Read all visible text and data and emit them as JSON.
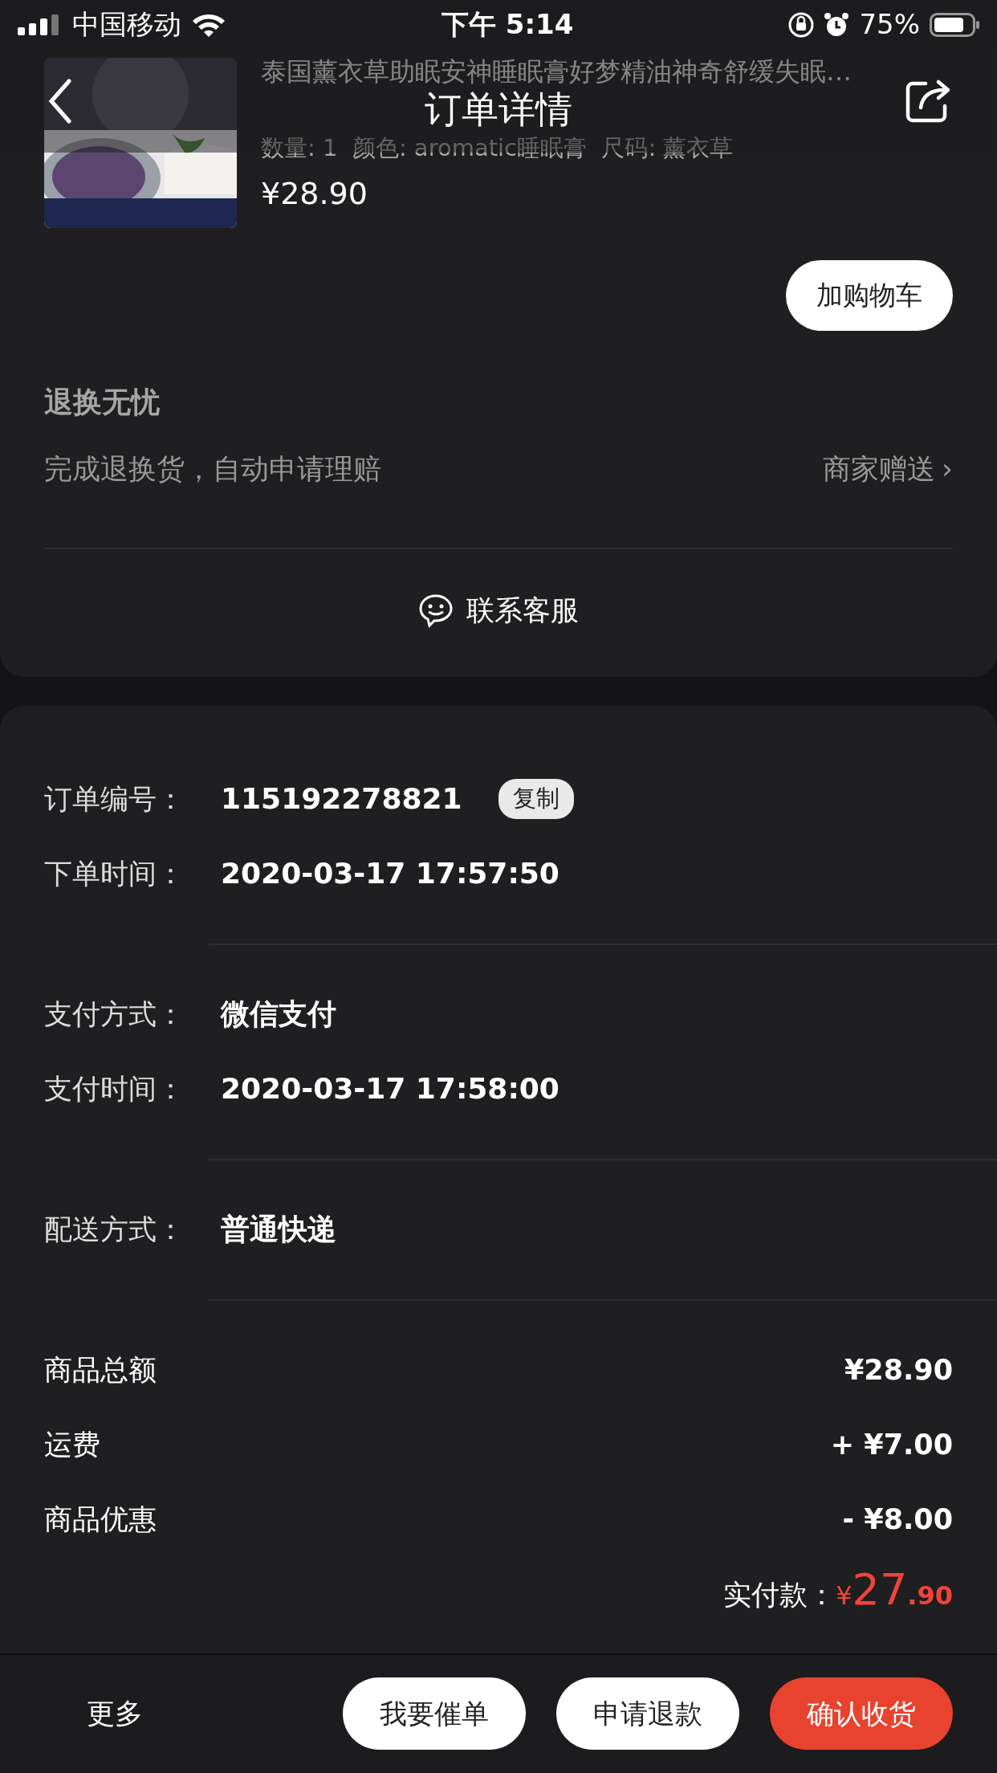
{
  "status_bar": {
    "carrier": "中国移动",
    "time": "下午 5:14",
    "battery": "75%"
  },
  "nav": {
    "title": "订单详情"
  },
  "product": {
    "title": "泰国薰衣草助眠安神睡眠膏好梦精油神奇舒缓失眠…",
    "specs": "数量: 1  颜色: aromatic睡眠膏  尺码: 薰衣草",
    "price": "¥28.90",
    "add_cart": "加购物车"
  },
  "guarantee": {
    "title": "退换无忧",
    "desc": "完成退换货，自动申请理赔",
    "note": "商家赠送",
    "chevron": "›"
  },
  "contact": "联系客服",
  "info_groups": [
    [
      {
        "label": "订单编号：",
        "value": "115192278821",
        "action": "复制"
      },
      {
        "label": "下单时间：",
        "value": "2020-03-17 17:57:50"
      }
    ],
    [
      {
        "label": "支付方式：",
        "value": "微信支付"
      },
      {
        "label": "支付时间：",
        "value": "2020-03-17 17:58:00"
      }
    ],
    [
      {
        "label": "配送方式：",
        "value": "普通快递"
      }
    ]
  ],
  "amounts": [
    {
      "label": "商品总额",
      "value": "¥28.90"
    },
    {
      "label": "运费",
      "value": "+ ¥7.00"
    },
    {
      "label": "商品优惠",
      "value": "- ¥8.00"
    }
  ],
  "total": {
    "label": "实付款：",
    "currency": "¥",
    "integer": "27",
    "decimal": ".90"
  },
  "bottom_bar": {
    "more": "更多",
    "buttons": [
      {
        "label": "我要催单",
        "kind": "outline"
      },
      {
        "label": "申请退款",
        "kind": "outline"
      },
      {
        "label": "确认收货",
        "kind": "primary"
      }
    ]
  }
}
